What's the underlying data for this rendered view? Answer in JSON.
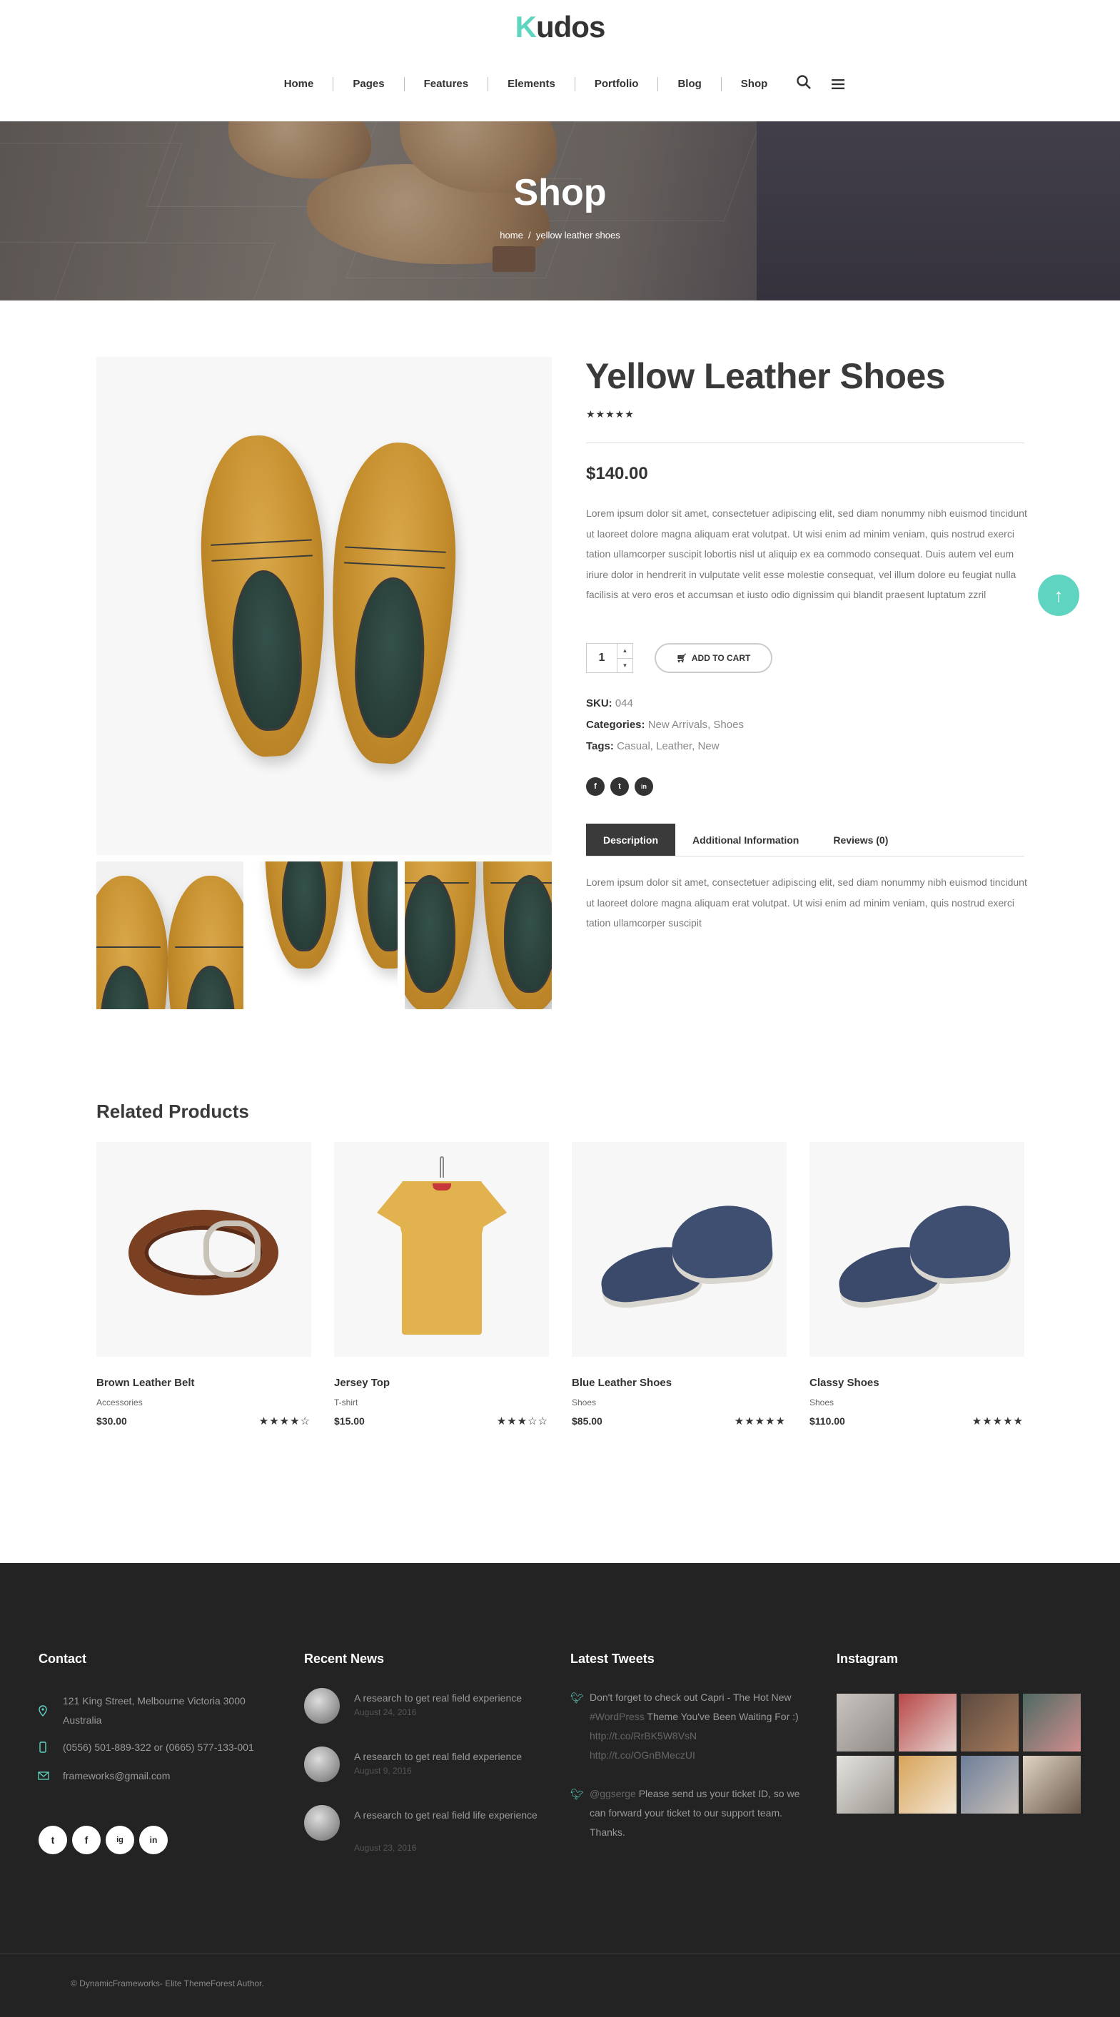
{
  "header": {
    "logo_k": "K",
    "logo_rest": "udos",
    "nav": [
      "Home",
      "Pages",
      "Features",
      "Elements",
      "Portfolio",
      "Blog",
      "Shop"
    ],
    "icons": [
      "search-icon",
      "menu-icon"
    ]
  },
  "hero": {
    "title": "Shop",
    "crumb_home": "home",
    "crumb_sep": "/",
    "crumb_current": "yellow leather shoes"
  },
  "product": {
    "title": "Yellow Leather Shoes",
    "rating": 5,
    "stars": "★★★★★",
    "price": "$140.00",
    "description": "Lorem ipsum dolor sit amet, consectetuer adipiscing elit, sed diam nonummy nibh euismod tincidunt ut laoreet dolore magna aliquam erat volutpat. Ut wisi enim ad minim veniam, quis nostrud exerci tation ullamcorper suscipit lobortis nisl ut aliquip ex ea commodo consequat. Duis autem vel eum iriure dolor in hendrerit in vulputate velit esse molestie consequat, vel illum dolore eu feugiat nulla facilisis at vero eros et accumsan et iusto odio dignissim qui blandit praesent luptatum zzril",
    "quantity": "1",
    "add_to_cart": "ADD TO CART",
    "sku_label": "SKU:",
    "sku": "044",
    "categories_label": "Categories:",
    "categories": [
      "New Arrivals",
      "Shoes"
    ],
    "tags_label": "Tags:",
    "tags": [
      "Casual",
      "Leather",
      "New"
    ],
    "share": [
      "f",
      "t",
      "in"
    ],
    "tabs": [
      "Description",
      "Additional Information",
      "Reviews (0)"
    ],
    "tab_description": "Lorem ipsum dolor sit amet, consectetuer adipiscing elit, sed diam nonummy nibh euismod tincidunt ut laoreet dolore magna aliquam erat volutpat. Ut wisi enim ad minim veniam, quis nostrud exerci tation ullamcorper suscipit"
  },
  "related": {
    "title": "Related Products",
    "items": [
      {
        "name": "Brown Leather Belt",
        "category": "Accessories",
        "price": "$30.00",
        "rating": 4,
        "stars": "★★★★☆"
      },
      {
        "name": "Jersey Top",
        "category": "T-shirt",
        "price": "$15.00",
        "rating": 3,
        "stars": "★★★☆☆"
      },
      {
        "name": "Blue Leather Shoes",
        "category": "Shoes",
        "price": "$85.00",
        "rating": 5,
        "stars": "★★★★★"
      },
      {
        "name": "Classy Shoes",
        "category": "Shoes",
        "price": "$110.00",
        "rating": 5,
        "stars": "★★★★★"
      }
    ]
  },
  "footer": {
    "contact_title": "Contact",
    "address": "121 King Street, Melbourne Victoria 3000 Australia",
    "phone": "(0556) 501-889-322 or (0665) 577-133-001",
    "email": "frameworks@gmail.com",
    "social": [
      "t",
      "f",
      "ig",
      "in"
    ],
    "news_title": "Recent News",
    "news": [
      {
        "title": "A research to get real field experience",
        "date": "August 24, 2016"
      },
      {
        "title": "A research to get real field experience",
        "date": "August 9, 2016"
      },
      {
        "title": "A research to get real field life experience",
        "date": "August 23, 2016"
      }
    ],
    "tweets_title": "Latest Tweets",
    "tweet1_a": "Don't forget to check out Capri - The Hot New ",
    "tweet1_tag": "#WordPress",
    "tweet1_b": " Theme You've Been Waiting For :) ",
    "tweet1_link1": "http://t.co/RrBK5W8VsN",
    "tweet1_link2": "http://t.co/OGnBMeczUI",
    "tweet2_user": "@ggserge",
    "tweet2_text": " Please send us your ticket ID, so we can forward your ticket to our support team. Thanks.",
    "instagram_title": "Instagram",
    "copyright": "© DynamicFrameworks- Elite ThemeForest Author."
  },
  "colors": {
    "accent": "#5fd4c0",
    "dark": "#232323",
    "text": "#3a3a3a"
  }
}
